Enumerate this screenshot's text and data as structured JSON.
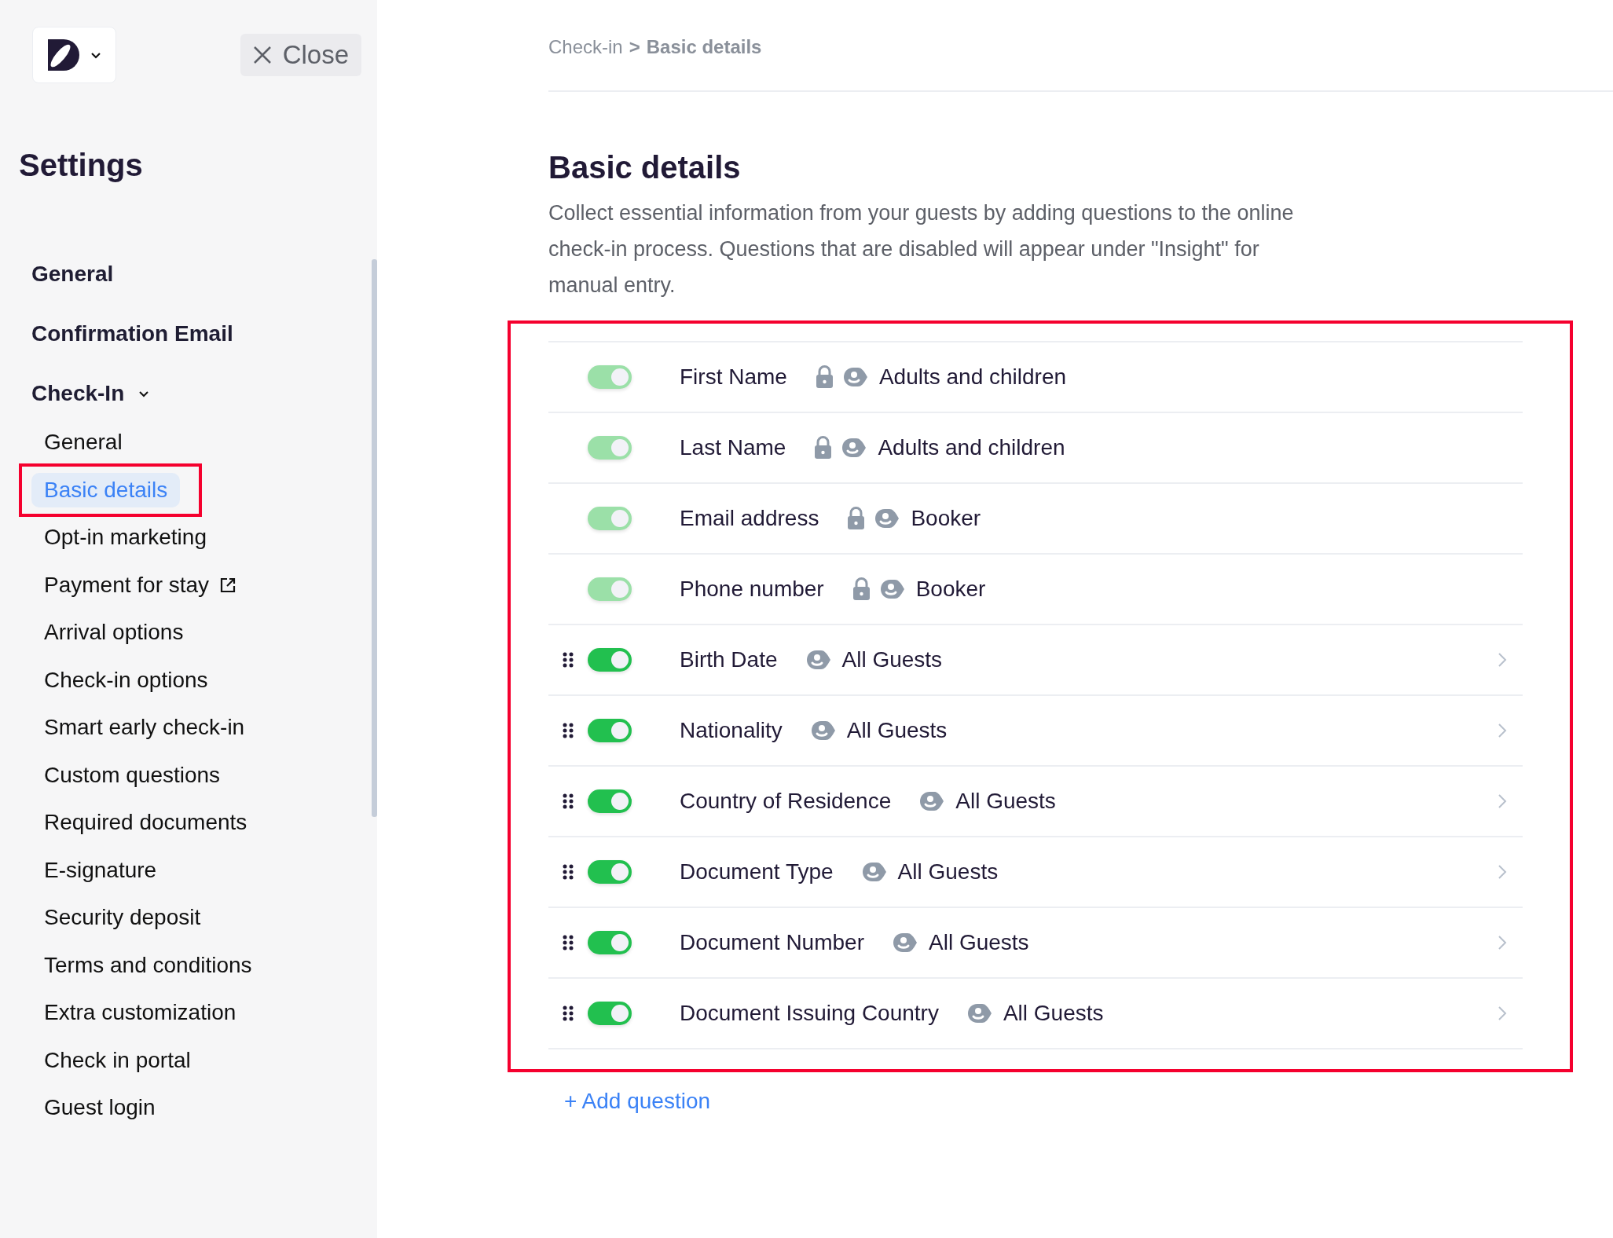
{
  "sidebar": {
    "close_label": "Close",
    "title": "Settings",
    "sections": [
      {
        "label": "General"
      },
      {
        "label": "Confirmation Email"
      },
      {
        "label": "Check-In",
        "expanded": true,
        "children": [
          {
            "label": "General",
            "selected": false,
            "highlighted": false,
            "external": false
          },
          {
            "label": "Basic details",
            "selected": true,
            "highlighted": true,
            "external": false
          },
          {
            "label": "Opt-in marketing",
            "selected": false,
            "highlighted": false,
            "external": false
          },
          {
            "label": "Payment for stay",
            "selected": false,
            "highlighted": false,
            "external": true
          },
          {
            "label": "Arrival options",
            "selected": false,
            "highlighted": false,
            "external": false
          },
          {
            "label": "Check-in options",
            "selected": false,
            "highlighted": false,
            "external": false
          },
          {
            "label": "Smart early check-in",
            "selected": false,
            "highlighted": false,
            "external": false
          },
          {
            "label": "Custom questions",
            "selected": false,
            "highlighted": false,
            "external": false
          },
          {
            "label": "Required documents",
            "selected": false,
            "highlighted": false,
            "external": false
          },
          {
            "label": "E-signature",
            "selected": false,
            "highlighted": false,
            "external": false
          },
          {
            "label": "Security deposit",
            "selected": false,
            "highlighted": false,
            "external": false
          },
          {
            "label": "Terms and conditions",
            "selected": false,
            "highlighted": false,
            "external": false
          },
          {
            "label": "Extra customization",
            "selected": false,
            "highlighted": false,
            "external": false
          },
          {
            "label": "Check in portal",
            "selected": false,
            "highlighted": false,
            "external": false
          },
          {
            "label": "Guest login",
            "selected": false,
            "highlighted": false,
            "external": false
          }
        ]
      }
    ]
  },
  "breadcrumb": {
    "parent": "Check-in",
    "separator": ">",
    "current": "Basic details"
  },
  "title": "Basic details",
  "description": "Collect essential information from your guests by adding questions to the online check-in process. Questions that are disabled will appear under \"Insight\" for manual entry.",
  "questions_highlighted": true,
  "questions": [
    {
      "label": "First Name",
      "audience": "Adults and children",
      "on": true,
      "locked": true
    },
    {
      "label": "Last Name",
      "audience": "Adults and children",
      "on": true,
      "locked": true
    },
    {
      "label": "Email address",
      "audience": "Booker",
      "on": true,
      "locked": true
    },
    {
      "label": "Phone number",
      "audience": "Booker",
      "on": true,
      "locked": true
    },
    {
      "label": "Birth Date",
      "audience": "All Guests",
      "on": true,
      "locked": false
    },
    {
      "label": "Nationality",
      "audience": "All Guests",
      "on": true,
      "locked": false
    },
    {
      "label": "Country of Residence",
      "audience": "All Guests",
      "on": true,
      "locked": false
    },
    {
      "label": "Document Type",
      "audience": "All Guests",
      "on": true,
      "locked": false
    },
    {
      "label": "Document Number",
      "audience": "All Guests",
      "on": true,
      "locked": false
    },
    {
      "label": "Document Issuing Country",
      "audience": "All Guests",
      "on": true,
      "locked": false
    }
  ],
  "add_question": "+ Add question"
}
